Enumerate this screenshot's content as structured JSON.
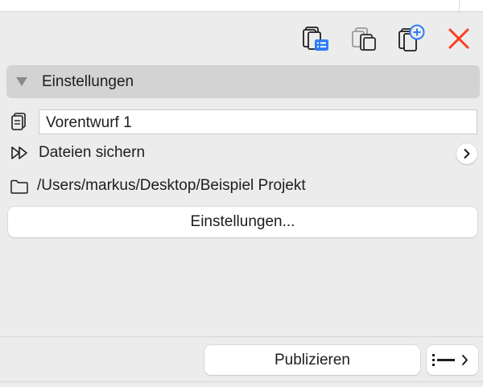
{
  "toolbar": {
    "icons": [
      "publish-list-icon",
      "duplicate-set-icon",
      "new-set-icon",
      "close-icon"
    ],
    "accent_color": "#2f7cf6",
    "close_color": "#ff3b1f"
  },
  "section": {
    "title": "Einstellungen",
    "expanded": true
  },
  "set_name": {
    "value": "Vorentwurf 1"
  },
  "method": {
    "label": "Dateien sichern"
  },
  "path": {
    "value": "/Users/markus/Desktop/Beispiel Projekt"
  },
  "settings_button": {
    "label": "Einstellungen..."
  },
  "footer": {
    "publish_label": "Publizieren"
  }
}
